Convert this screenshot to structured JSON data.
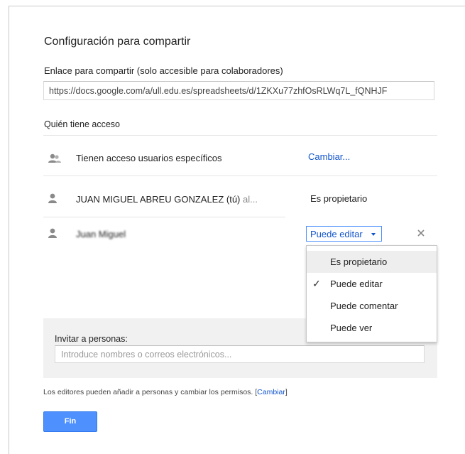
{
  "dialog": {
    "title": "Configuración para compartir",
    "link_label": "Enlace para compartir (solo accesible para colaboradores)",
    "link_url": "https://docs.google.com/a/ull.edu.es/spreadsheets/d/1ZKXu77zhfOsRLWq7L_fQNHJF"
  },
  "access": {
    "heading": "Quién tiene acceso",
    "visibility_text": "Tienen acceso usuarios específicos",
    "change_link": "Cambiar...",
    "people": [
      {
        "name": "JUAN MIGUEL ABREU GONZALEZ (tú)",
        "email_hint": "al...",
        "role": "Es propietario"
      },
      {
        "name": "Juan Miguel",
        "role": "Puede editar"
      }
    ]
  },
  "role_menu": {
    "options": [
      "Es propietario",
      "Puede editar",
      "Puede comentar",
      "Puede ver"
    ],
    "selected_index": 1,
    "highlighted_index": 0,
    "check_glyph": "✓"
  },
  "invite": {
    "label": "Invitar a personas:",
    "placeholder": "Introduce nombres o correos electrónicos..."
  },
  "footer": {
    "note": "Los editores pueden añadir a personas y cambiar los permisos.",
    "bracket_open": "[",
    "link": "Cambiar",
    "bracket_close": "]"
  },
  "done_button": "Fin",
  "colors": {
    "accent": "#4d90fe",
    "link": "#1155cc",
    "panel": "#f1f1f1"
  },
  "icons": {
    "visibility": "people-icon",
    "person": "person-icon",
    "remove": "close-icon",
    "dropdown": "caret-down-icon"
  }
}
